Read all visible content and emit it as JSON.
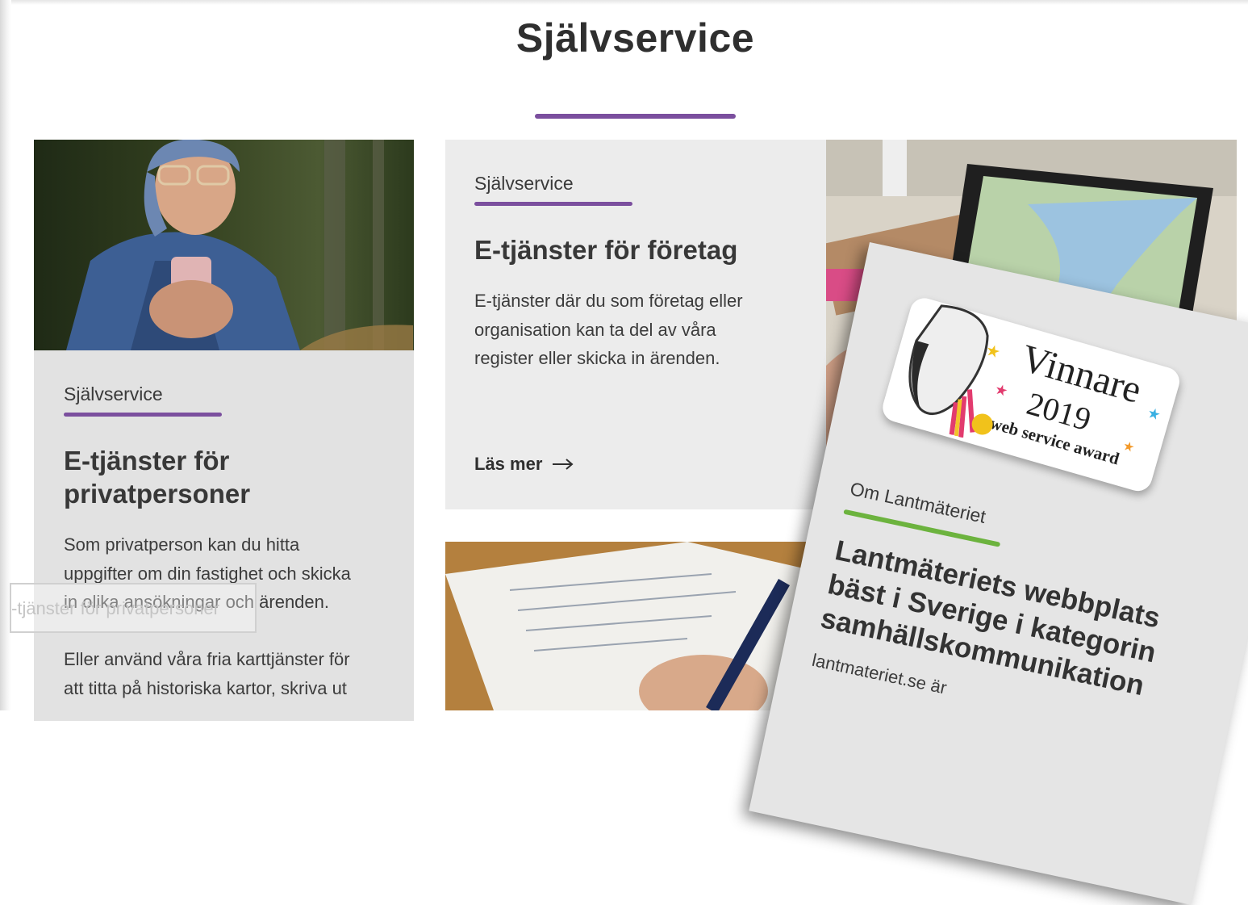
{
  "page": {
    "title": "Självservice"
  },
  "cards": [
    {
      "category": "Självservice",
      "heading_line1": "E-tjänster för",
      "heading_line2": "privatpersoner",
      "text1_lines": [
        "Som privatperson kan du hitta",
        "uppgifter om din fastighet och skicka",
        "in olika ansökningar och ärenden."
      ],
      "text2_lines": [
        "Eller använd våra fria karttjänster för",
        "att titta på historiska kartor, skriva ut"
      ],
      "image": "woman-with-phone-photo"
    },
    {
      "category": "Självservice",
      "heading": "E-tjänster för företag",
      "text_lines": [
        "E-tjänster där du som företag eller",
        "organisation kan ta del av våra",
        "register eller skicka in ärenden."
      ],
      "link_label": "Läs mer",
      "image": "tablet-map-photo"
    }
  ],
  "ghost_label": "-tjänster för privatpersoner",
  "award_clipping": {
    "badge_line1": "Vinnare",
    "badge_year": "2019",
    "badge_sub": "web service award",
    "category": "Om Lantmäteriet",
    "heading_lines": [
      "Lantmäteriets webbplats",
      "bäst i Sverige i kategorin",
      "samhällskommunikation"
    ],
    "text": "lantmateriet.se är"
  },
  "colors": {
    "accent_purple": "#7b4f9e",
    "accent_green": "#6cb33e",
    "card_bg": "#e2e2e2"
  }
}
